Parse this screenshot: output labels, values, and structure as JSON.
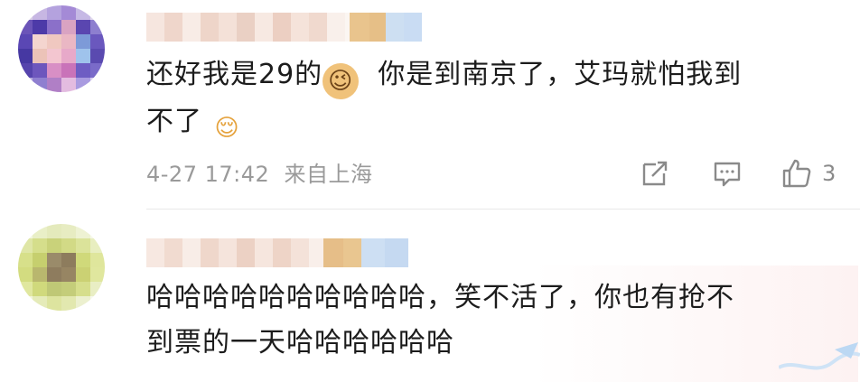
{
  "comments": [
    {
      "line1_a": "还好我是29的",
      "emoji1": "😉",
      "line1_b": "你是到南京了，艾玛就怕我到",
      "line2": "不了",
      "emoji2": "😌",
      "timestamp": "4-27 17:42",
      "location": "来自上海",
      "like_count": "3",
      "icons": [
        "share-icon",
        "comment-icon",
        "thumbs-up-icon"
      ]
    },
    {
      "line1": "哈哈哈哈哈哈哈哈哈哈，笑不活了，你也有抢不",
      "line2": "到票的一天哈哈哈哈哈哈"
    }
  ],
  "colors": {
    "text": "#1c1c1c",
    "meta": "#9a9a9a",
    "divider": "#e8e8e8"
  }
}
